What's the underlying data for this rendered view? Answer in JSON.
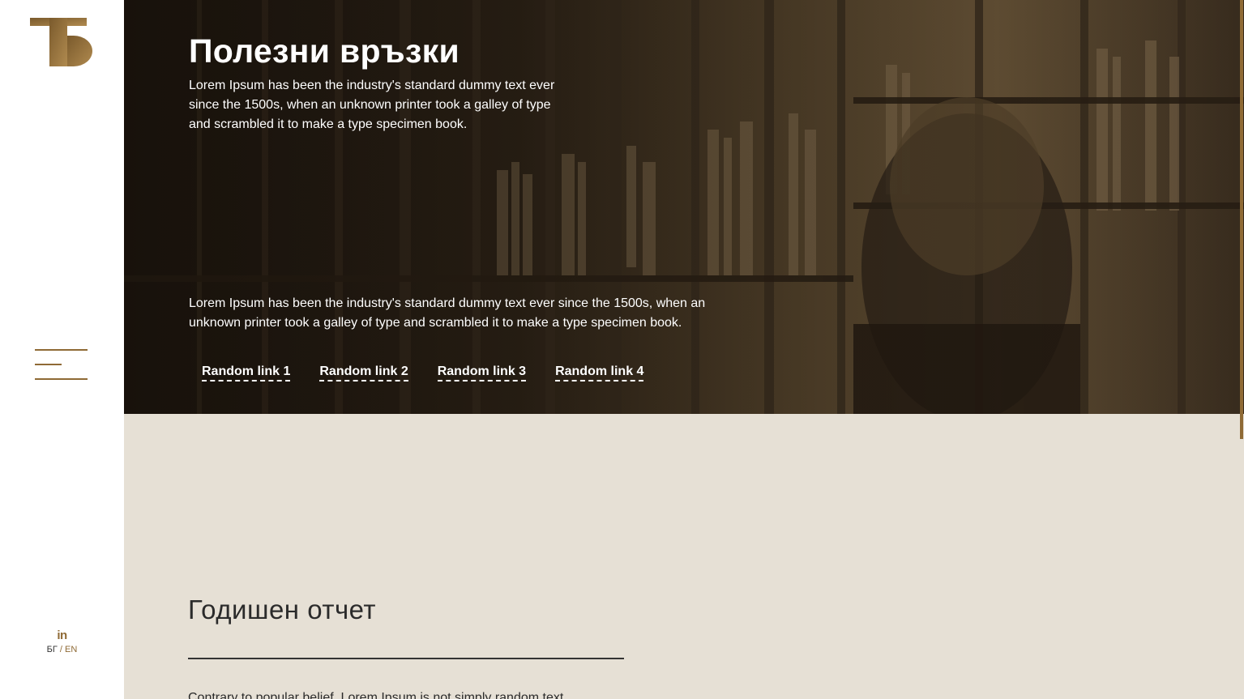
{
  "sidebar": {
    "logo_label": "ТБ",
    "menu_icon": "hamburger-menu-icon",
    "social_icon": "linkedin-icon",
    "social_label": "in",
    "languages": {
      "bg": "БГ",
      "separator": "/",
      "en": "EN"
    }
  },
  "hero": {
    "title": "Полезни връзки",
    "intro": "Lorem Ipsum has been the industry's standard dummy text ever since the 1500s, when an unknown printer took a galley of type and scrambled it to make a type specimen book.",
    "description": "Lorem Ipsum has been the industry's standard dummy text ever since the 1500s, when an unknown printer took a galley of type and scrambled it to make a type specimen book.",
    "links": [
      "Random link 1",
      "Random link 2",
      "Random link 3",
      "Random link 4"
    ]
  },
  "report": {
    "title": "Годишен отчет",
    "text": "Contrary to popular belief, Lorem Ipsum is not simply random text."
  },
  "colors": {
    "accent": "#8f6a35",
    "content_background": "#e6e0d5",
    "sidebar_background": "#ffffff"
  }
}
